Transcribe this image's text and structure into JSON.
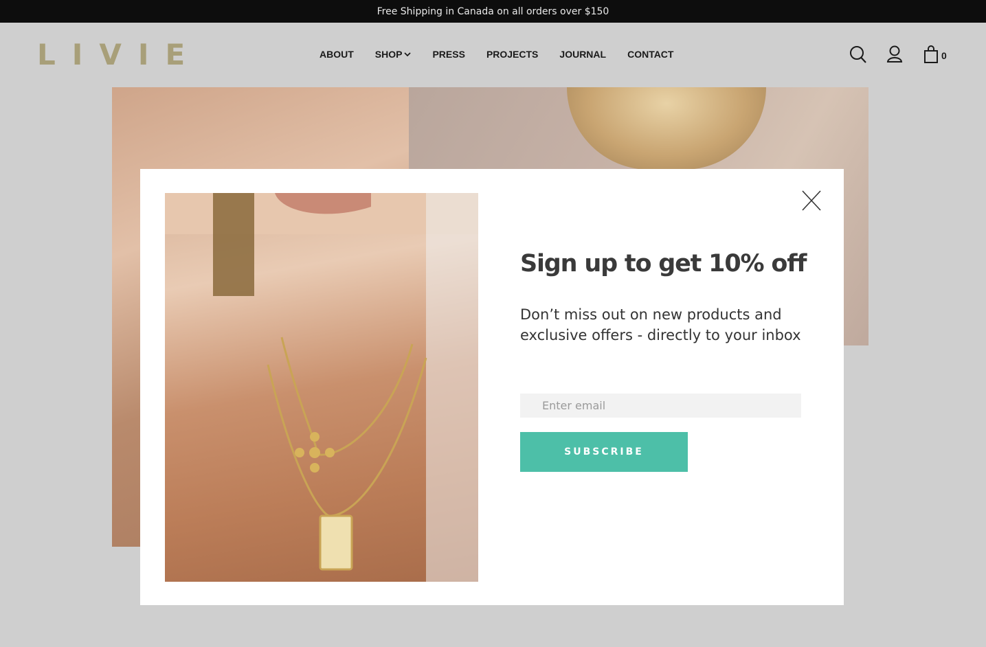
{
  "announcement": "Free Shipping in Canada on all orders over $150",
  "brand": {
    "logo_text": "LIVIE",
    "color": "#a89f79"
  },
  "nav": {
    "items": [
      "ABOUT",
      "SHOP",
      "PRESS",
      "PROJECTS",
      "JOURNAL",
      "CONTACT"
    ]
  },
  "header_icons": {
    "search": "search-icon",
    "account": "user-icon",
    "cart": "shopping-bag-icon",
    "cart_count": "0"
  },
  "popup": {
    "title": "Sign up to get 10% off",
    "subtitle": "Don’t miss out on new products and exclusive offers - directly to your inbox",
    "email_placeholder": "Enter email",
    "subscribe_label": "SUBSCRIBE",
    "accent_color": "#4dbfa8"
  }
}
